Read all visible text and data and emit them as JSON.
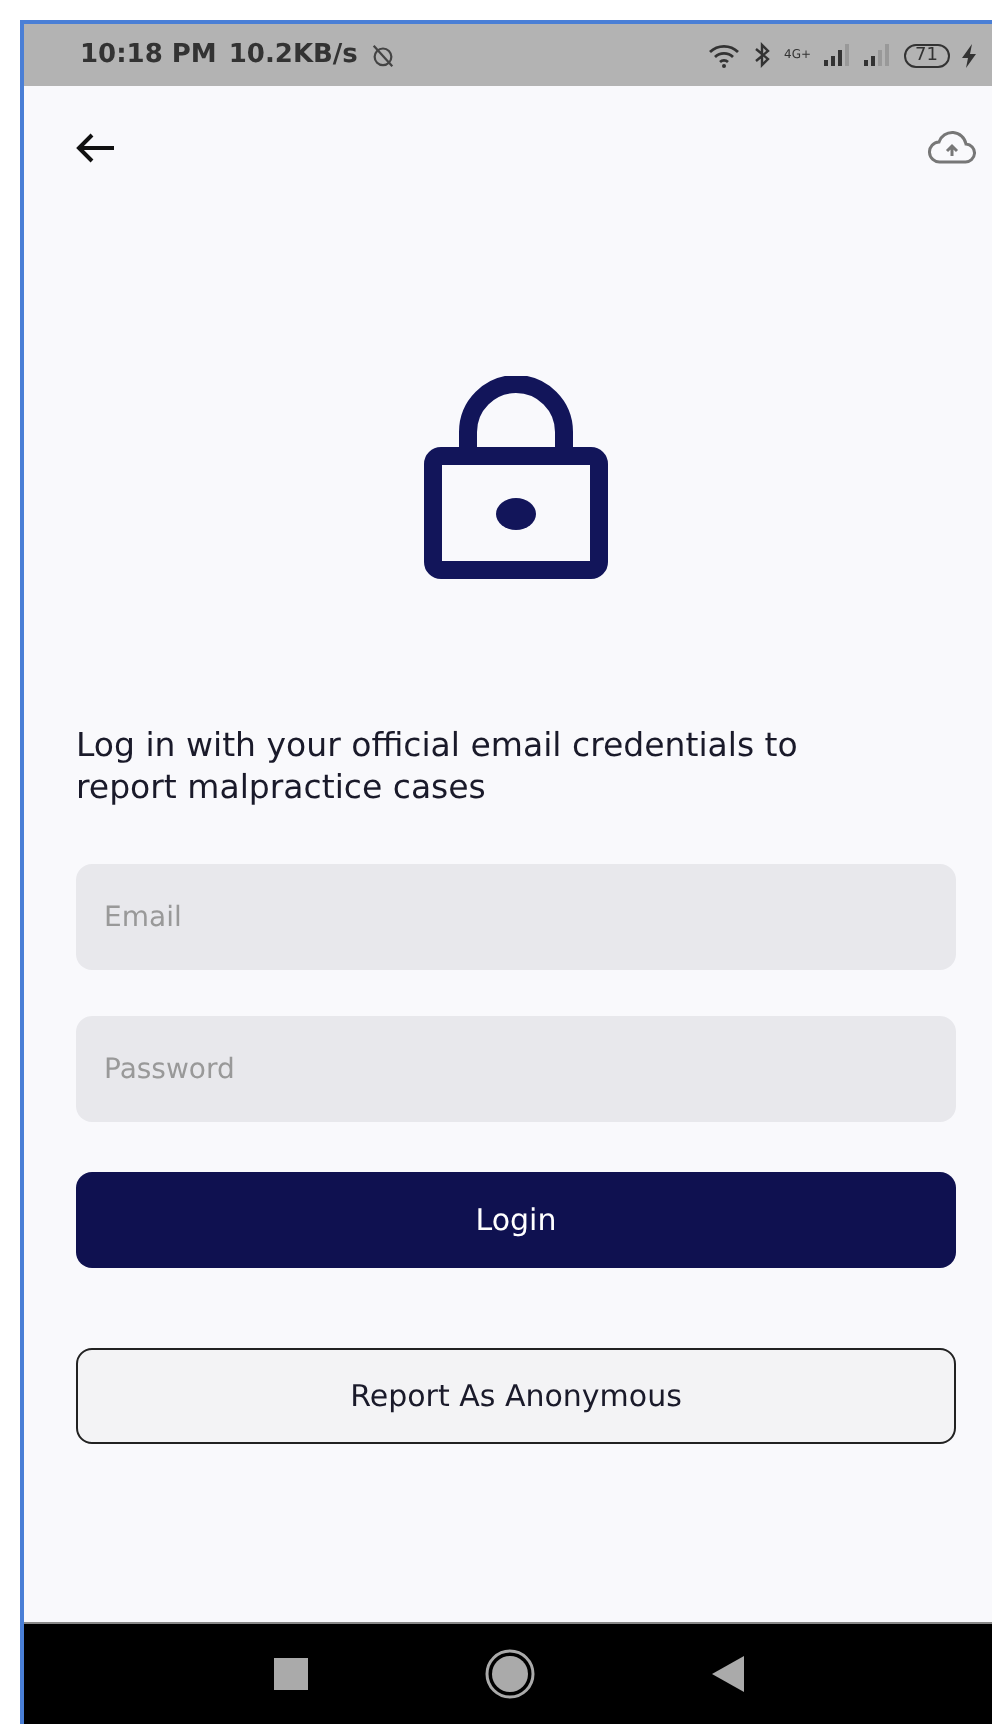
{
  "status_bar": {
    "time": "10:18 PM",
    "speed": "10.2KB/s",
    "network": "4G+",
    "battery": "71"
  },
  "prompt": "Log in with your official email credentials to report malpractice cases",
  "fields": [
    {
      "placeholder": "Email"
    },
    {
      "placeholder": "Password"
    }
  ],
  "login_button": "Login",
  "anonymous_button": "Report As Anonymous"
}
